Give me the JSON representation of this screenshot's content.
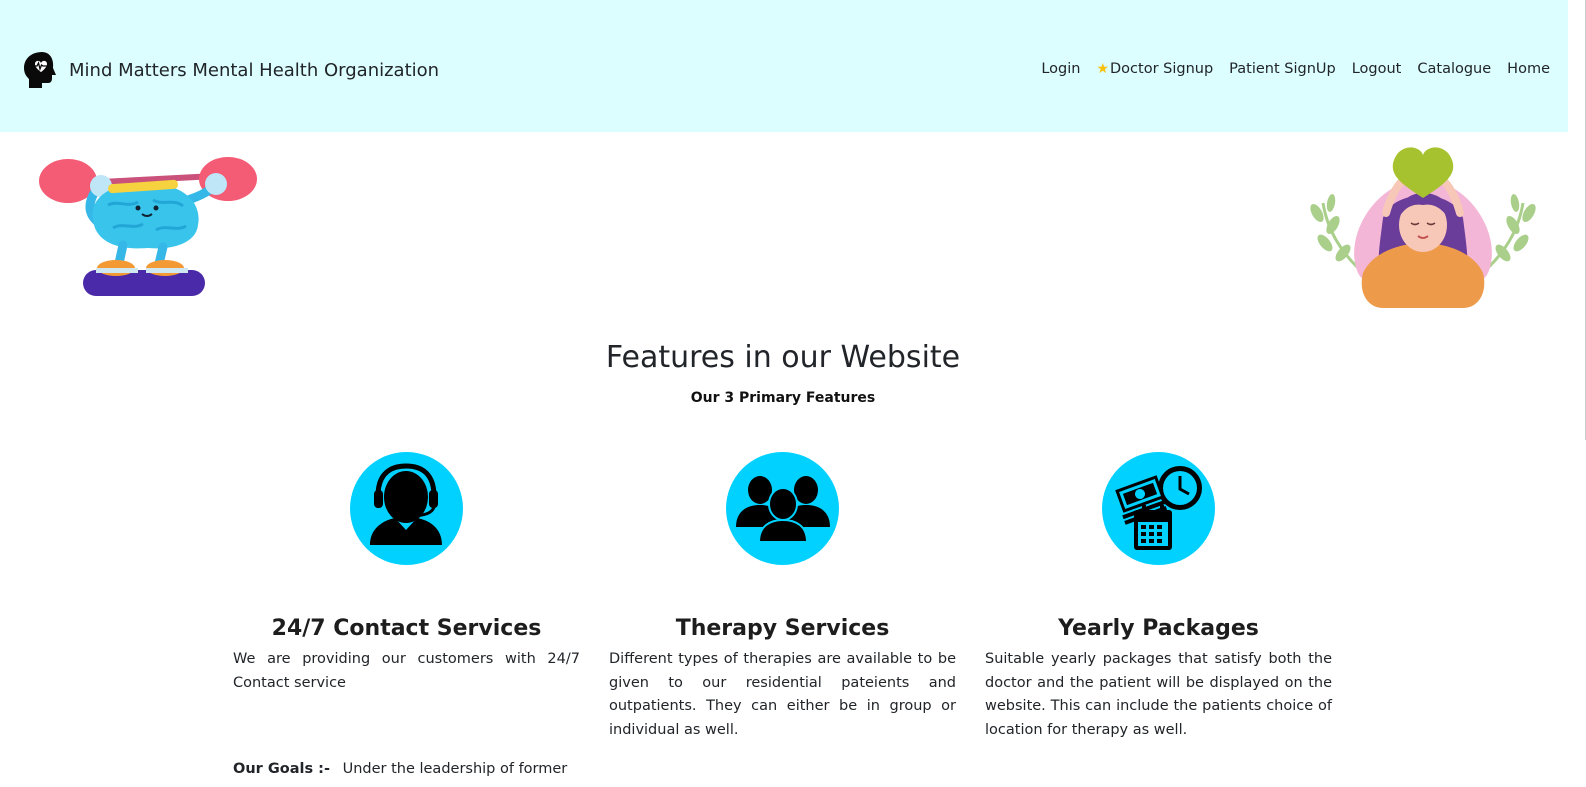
{
  "brand": {
    "name": "Mind Matters Mental Health Organization",
    "logo_icon": "head-heart-icon"
  },
  "nav": {
    "items": [
      {
        "label": "Login"
      },
      {
        "label": "Doctor Signup",
        "icon": "star-icon"
      },
      {
        "label": "Patient SignUp"
      },
      {
        "label": "Logout"
      },
      {
        "label": "Catalogue"
      },
      {
        "label": "Home"
      }
    ]
  },
  "features": {
    "title": "Features in our Website",
    "subtitle": "Our 3 Primary Features",
    "items": [
      {
        "icon": "headset-support-icon",
        "title": "24/7 Contact Services",
        "description": "We are providing our customers with 24/7 Contact service"
      },
      {
        "icon": "group-people-icon",
        "title": "Therapy Services",
        "description": "Different types of therapies are available to be given to our residential pateients and outpatients. They can either be in group or individual as well."
      },
      {
        "icon": "money-calendar-clock-icon",
        "title": "Yearly Packages",
        "description": "Suitable yearly packages that satisfy both the doctor and the patient will be displayed on the website. This can include the patients choice of location for therapy as well."
      }
    ]
  },
  "goals": {
    "label": "Our Goals :-",
    "text": "Under the leadership of former"
  },
  "colors": {
    "navbar_bg": "#dcfefe",
    "icon_circle": "#00d1ff",
    "star": "#f8c20c"
  }
}
